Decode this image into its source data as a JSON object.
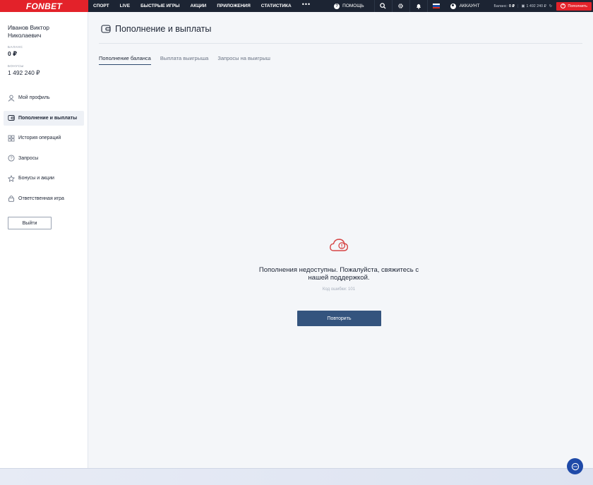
{
  "brand": {
    "logo": "FONBET",
    "accent": "#e3222a",
    "dark": "#1c2433",
    "button": "#34547e"
  },
  "topnav": {
    "items": [
      "СПОРТ",
      "LIVE",
      "БЫСТРЫЕ ИГРЫ",
      "АКЦИИ",
      "ПРИЛОЖЕНИЯ",
      "СТАТИСТИКА"
    ],
    "more": "•••",
    "help": "ПОМОЩЬ",
    "account": "АККАУНТ",
    "balance_label": "Баланс:",
    "balance_value": "0 ₽",
    "bonus_value": "1 492 240 ₽",
    "deposit": "Пополнить"
  },
  "sidebar": {
    "user_name": "Иванов Виктор Николаевич",
    "balance_label": "БАЛАНС",
    "balance": "0 ₽",
    "bonus_label": "БОНУСЫ",
    "bonus": "1 492 240 ₽",
    "menu": [
      {
        "label": "Мой профиль",
        "icon": "user-icon"
      },
      {
        "label": "Пополнение и выплаты",
        "icon": "wallet-icon",
        "active": true
      },
      {
        "label": "История операций",
        "icon": "grid-icon"
      },
      {
        "label": "Запросы",
        "icon": "question-icon"
      },
      {
        "label": "Бонусы и акции",
        "icon": "star-icon"
      },
      {
        "label": "Ответственная игра",
        "icon": "lock-icon"
      }
    ],
    "logout": "Выйти"
  },
  "main": {
    "title": "Пополнение и выплаты",
    "tabs": [
      "Пополнение баланса",
      "Выплата выигрыша",
      "Запросы на выигрыш"
    ],
    "active_tab": 0,
    "error_message": "Пополнения недоступны. Пожалуйста, свяжитесь с нашей поддержкой.",
    "error_code": "Код ошибки: 101",
    "retry": "Повторить"
  }
}
